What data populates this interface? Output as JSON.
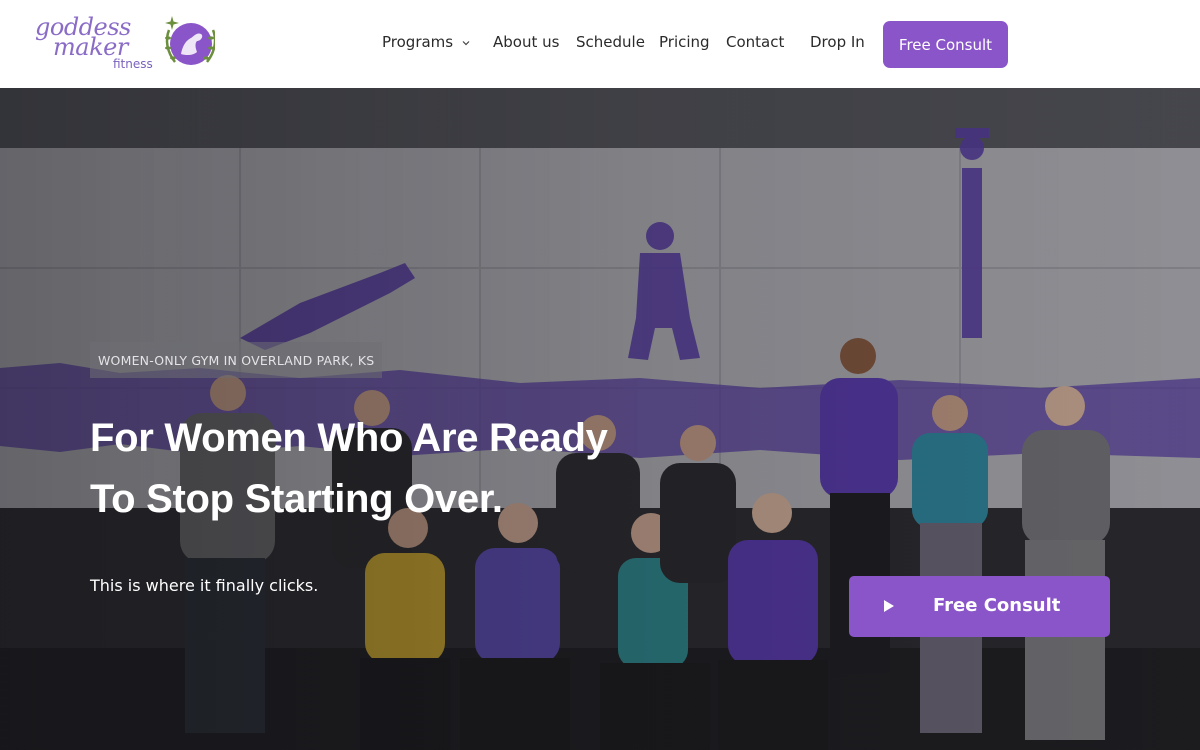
{
  "brand": {
    "logo_text_line1": "goddess",
    "logo_text_line2": "maker",
    "logo_text_line3": "fitness",
    "accent_color": "#8a55c8"
  },
  "nav": {
    "items": [
      {
        "label": "Programs",
        "has_dropdown": true
      },
      {
        "label": "About us"
      },
      {
        "label": "Schedule"
      },
      {
        "label": "Pricing"
      },
      {
        "label": "Contact"
      },
      {
        "label": "Drop In"
      }
    ],
    "cta_label": "Free Consult"
  },
  "hero": {
    "eyebrow": "WOMEN-ONLY GYM IN OVERLAND PARK, KS",
    "headline_line1": "For Women Who Are Ready",
    "headline_line2": "To Stop Starting Over.",
    "subline": "This is where it finally clicks.",
    "cta_label": "Free Consult",
    "cta_icon": "play-icon",
    "background_image": "group photo of women flexing in front of a purple gym mural"
  }
}
